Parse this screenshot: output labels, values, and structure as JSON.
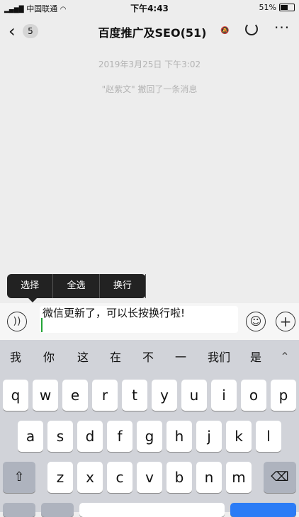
{
  "status": {
    "carrier": "中国联通",
    "time": "下午4:43",
    "battery": "51%"
  },
  "nav": {
    "back_badge": "5",
    "title": "百度推广及SEO(51)"
  },
  "chat": {
    "timestamp": "2019年3月25日 下午3:02",
    "system_message": "\"赵紫文\" 撤回了一条消息"
  },
  "context_menu": {
    "items": [
      "选择",
      "全选",
      "换行"
    ]
  },
  "input": {
    "value": "微信更新了，可以长按换行啦!"
  },
  "keyboard": {
    "candidates": [
      "我",
      "你",
      "这",
      "在",
      "不",
      "一",
      "我们",
      "是"
    ],
    "row1": [
      "q",
      "w",
      "e",
      "r",
      "t",
      "y",
      "u",
      "i",
      "o",
      "p"
    ],
    "row2": [
      "a",
      "s",
      "d",
      "f",
      "g",
      "h",
      "j",
      "k",
      "l"
    ],
    "row3": [
      "z",
      "x",
      "c",
      "v",
      "b",
      "n",
      "m"
    ]
  }
}
